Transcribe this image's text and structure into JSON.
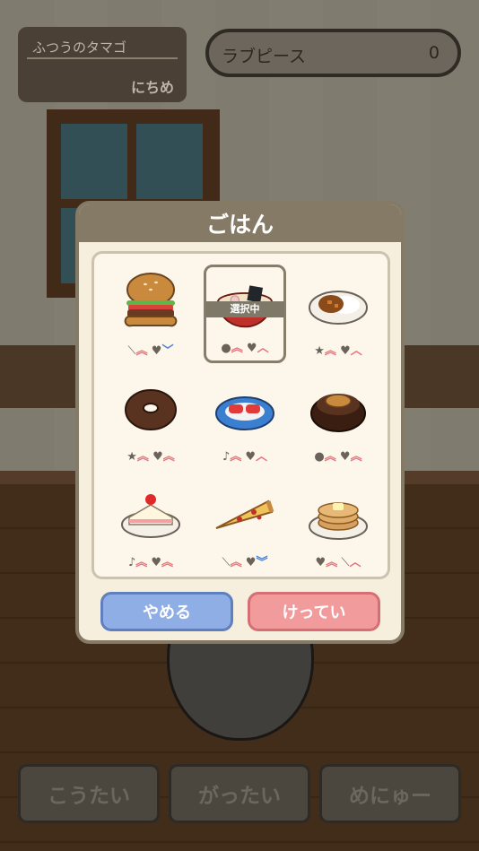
{
  "hud": {
    "egg_name": "ふつうのタマゴ",
    "egg_days": "にちめ",
    "love_piece_label": "ラブピース",
    "love_piece_value": "0"
  },
  "dialog": {
    "title": "ごはん",
    "cancel_label": "やめる",
    "confirm_label": "けってい",
    "selected_badge": "選択中",
    "foods": [
      {
        "name": "hamburger",
        "stats": [
          {
            "icon": "⟍",
            "dir": "︽"
          },
          {
            "icon": "♥",
            "dir": "﹀"
          }
        ]
      },
      {
        "name": "ramen",
        "stats": [
          {
            "icon": "●",
            "dir": "︽"
          },
          {
            "icon": "♥",
            "dir": "︿"
          }
        ]
      },
      {
        "name": "curry-rice",
        "stats": [
          {
            "icon": "★",
            "dir": "︽"
          },
          {
            "icon": "♥",
            "dir": "︿"
          }
        ]
      },
      {
        "name": "donut",
        "stats": [
          {
            "icon": "★",
            "dir": "︽"
          },
          {
            "icon": "♥",
            "dir": "︽"
          }
        ]
      },
      {
        "name": "sushi",
        "stats": [
          {
            "icon": "♪",
            "dir": "︽"
          },
          {
            "icon": "♥",
            "dir": "︿"
          }
        ]
      },
      {
        "name": "chocolate-cake",
        "stats": [
          {
            "icon": "●",
            "dir": "︽"
          },
          {
            "icon": "♥",
            "dir": "︽"
          }
        ]
      },
      {
        "name": "strawberry-shortcake",
        "stats": [
          {
            "icon": "♪",
            "dir": "︽"
          },
          {
            "icon": "♥",
            "dir": "︽"
          }
        ]
      },
      {
        "name": "pizza",
        "stats": [
          {
            "icon": "⟍",
            "dir": "︽"
          },
          {
            "icon": "♥",
            "dir": "︾"
          }
        ]
      },
      {
        "name": "pancakes",
        "stats": [
          {
            "icon": "♥",
            "dir": "︽"
          },
          {
            "icon": "⟍",
            "dir": "︿"
          }
        ]
      }
    ]
  },
  "bottom_buttons": [
    "こうたい",
    "がったい",
    "めにゅー"
  ],
  "colors": {
    "dialog_header": "#857a66",
    "cancel": "#8faee6",
    "confirm": "#f29b9d",
    "stat_up": "#e8707a",
    "stat_down": "#4a7fd6"
  }
}
